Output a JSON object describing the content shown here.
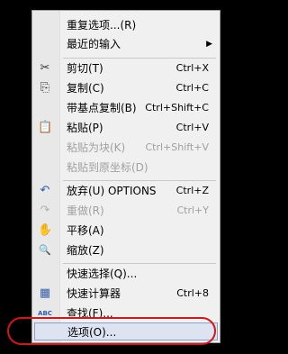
{
  "menu": {
    "items": [
      {
        "label": "重复选项...(R)",
        "shortcut": "",
        "icon": ""
      },
      {
        "label": "最近的输入",
        "shortcut": "",
        "icon": "",
        "arrow": "▶"
      },
      {
        "label": "剪切(T)",
        "shortcut": "Ctrl+X",
        "icon": "✂"
      },
      {
        "label": "复制(C)",
        "shortcut": "Ctrl+C",
        "icon": "⎘"
      },
      {
        "label": "带基点复制(B)",
        "shortcut": "Ctrl+Shift+C",
        "icon": ""
      },
      {
        "label": "粘贴(P)",
        "shortcut": "Ctrl+V",
        "icon": "📋"
      },
      {
        "label": "粘贴为块(K)",
        "shortcut": "Ctrl+Shift+V",
        "icon": ""
      },
      {
        "label": "粘贴到原坐标(D)",
        "shortcut": "",
        "icon": ""
      },
      {
        "label": "放弃(U) OPTIONS",
        "shortcut": "Ctrl+Z",
        "icon": "↶"
      },
      {
        "label": "重做(R)",
        "shortcut": "Ctrl+Y",
        "icon": "↷"
      },
      {
        "label": "平移(A)",
        "shortcut": "",
        "icon": "✋"
      },
      {
        "label": "缩放(Z)",
        "shortcut": "",
        "icon": "🔍"
      },
      {
        "label": "快速选择(Q)...",
        "shortcut": "",
        "icon": ""
      },
      {
        "label": "快速计算器",
        "shortcut": "Ctrl+8",
        "icon": "▦"
      },
      {
        "label": "查找(F)...",
        "shortcut": "",
        "icon": "ABC"
      },
      {
        "label": "选项(O)...",
        "shortcut": "",
        "icon": ""
      }
    ]
  },
  "colors": {
    "highlight_oval": "#d01818",
    "selected_bg": "#dde3f0"
  }
}
